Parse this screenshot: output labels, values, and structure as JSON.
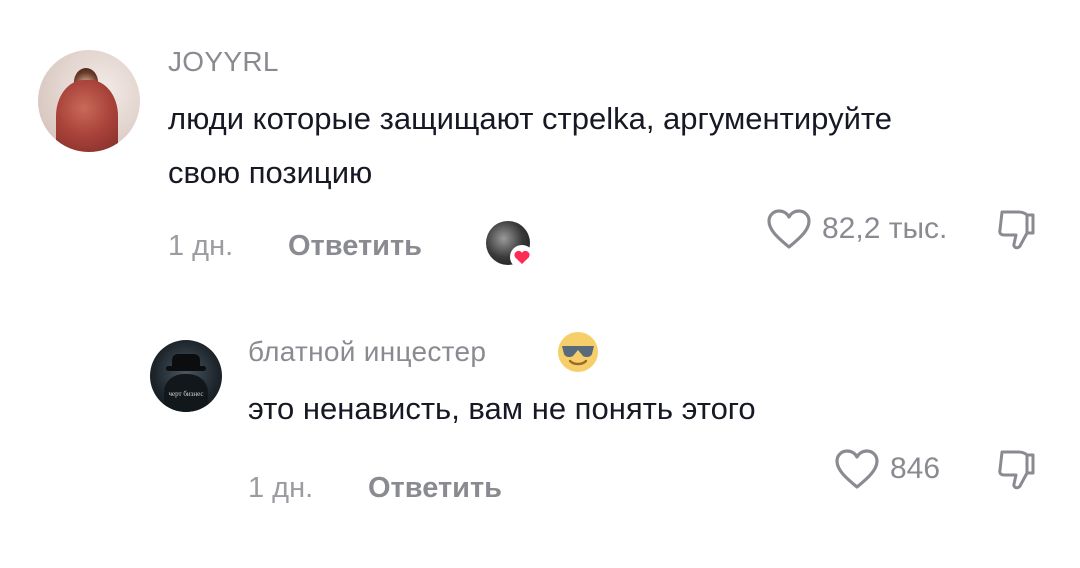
{
  "comments": [
    {
      "username": "JOYYRL",
      "text_line1": "люди которые защищают стреlka, аргументируйте",
      "text_line2": "свою позицию",
      "time": "1 дн.",
      "reply_label": "Ответить",
      "likes": "82,2 тыс."
    },
    {
      "username": "блатной инцестер",
      "text": "это ненависть, вам не понять этого",
      "time": "1 дн.",
      "reply_label": "Ответить",
      "likes": "846",
      "avatar_caption": "черт бизнес"
    }
  ],
  "icons": {
    "like": "heart-outline-icon",
    "dislike": "thumbs-down-icon",
    "creator_liked": "heart-badge-icon",
    "username_emoji": "sunglasses-emoji-icon"
  },
  "colors": {
    "text": "#161823",
    "muted": "#8a8b91",
    "heart_badge": "#fe2c55",
    "emoji_face": "#f6cf6a"
  }
}
